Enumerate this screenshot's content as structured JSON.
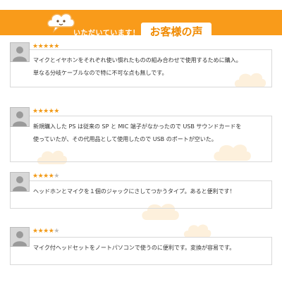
{
  "header": {
    "subtitle": "いただいています！",
    "title": "お客様の声",
    "bar_color": "#f99b1a",
    "title_color": "#f08a00"
  },
  "reviews": [
    {
      "rating": 5,
      "lines": [
        "マイクとイヤホンをそれぞれ使い慣れたものの組み合わせで使用するために購入。",
        "単なる分岐ケーブルなので特に不可な点も無しです。"
      ]
    },
    {
      "rating": 5,
      "lines": [
        "新規購入した PS は従来の SP と MIC 端子がなかったので USB サウンドカードを",
        "使っていたが、その代用品として使用したので USB のポートが空いた。"
      ]
    },
    {
      "rating": 4,
      "lines": [
        "ヘッドホンとマイクを１個のジャックにさしてつかうタイプ。あると便利です！"
      ]
    },
    {
      "rating": 4,
      "lines": [
        "マイク付ヘッドセットをノートパソコンで使うのに便利です。変換が容易です。"
      ]
    }
  ],
  "icons": {
    "avatar": "user-avatar-icon",
    "mascot": "cloud-mascot-icon",
    "star": "star-icon"
  },
  "colors": {
    "star_on": "#f29a17",
    "star_off": "#bdbdbd"
  }
}
